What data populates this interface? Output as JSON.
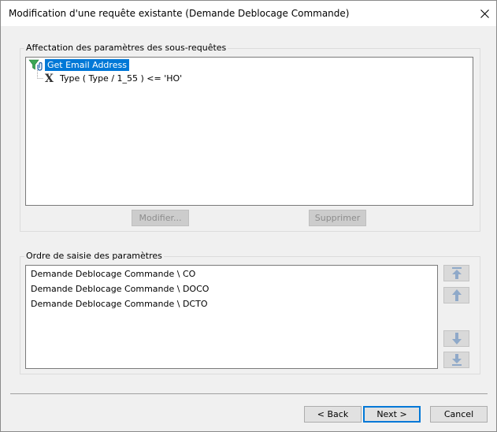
{
  "window": {
    "title": "Modification d'une requête existante (Demande Deblocage Commande)"
  },
  "subqueries": {
    "group_label": "Affectation des paramètres des sous-requêtes",
    "tree": {
      "root_label": "Get Email Address",
      "child_label": "Type ( Type / 1_55 ) <= 'HO'"
    },
    "modify_label": "Modifier...",
    "delete_label": "Supprimer"
  },
  "param_order": {
    "group_label": "Ordre de saisie des paramètres",
    "items": [
      "Demande Deblocage Commande \\ CO",
      "Demande Deblocage Commande \\ DOCO",
      "Demande Deblocage Commande \\ DCTO"
    ]
  },
  "footer": {
    "back_label": "< Back",
    "next_label": "Next >",
    "cancel_label": "Cancel"
  },
  "colors": {
    "selection": "#0078d7",
    "arrow": "#8fa9c9"
  }
}
